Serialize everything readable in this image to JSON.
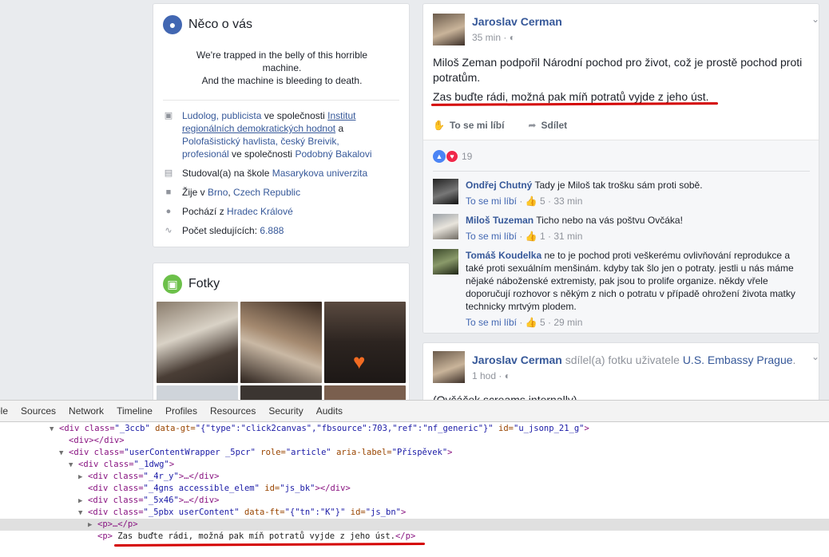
{
  "about": {
    "title": "Něco o vás",
    "quote_line1": "We're trapped in the belly of this horrible",
    "quote_line2": "machine.",
    "quote_line3": "And the machine is bleeding to death.",
    "work": {
      "role_link": "Ludolog, publicista",
      "at1": " ve společnosti ",
      "org1": "Institut regionálních demokratických hodnot",
      "and": " a ",
      "role2": "Polofašistický havlista, český Breivik, profesionál",
      "at2": " ve společnosti ",
      "org2": "Podobný Bakalovi"
    },
    "studied_prefix": "Studoval(a) na škole ",
    "studied_link": "Masarykova univerzita",
    "lives_prefix": "Žije v ",
    "lives_city": "Brno",
    "lives_sep": ", ",
    "lives_country": "Czech Republic",
    "from_prefix": "Pochází z ",
    "from_link": "Hradec Králové",
    "followers_prefix": "Počet sledujících: ",
    "followers_count": "6.888"
  },
  "photos": {
    "title": "Fotky"
  },
  "post": {
    "author": "Jaroslav Cerman",
    "time": "35 min",
    "privacy_icon": "globe-icon",
    "text1": "Miloš Zeman podpořil Národní pochod pro život, což je prostě pochod proti potratům.",
    "text2": "Zas buďte rádi, možná pak míň potratů vyjde z jeho úst.",
    "like_label": "To se mi líbí",
    "share_label": "Sdílet",
    "reaction_count": "19",
    "comments": [
      {
        "name": "Ondřej Chutný",
        "text": "Tady je Miloš tak trošku sám proti sobě.",
        "like": "To se mi líbí",
        "likes": "5",
        "time": "33 min"
      },
      {
        "name": "Miloš Tuzeman",
        "text": "Ticho nebo na vás poštvu Ovčáka!",
        "like": "To se mi líbí",
        "likes": "1",
        "time": "31 min"
      },
      {
        "name": "Tomáš Koudelka",
        "text": "ne to je pochod proti veškerému ovlivňování reprodukce a také proti sexuálním menšinám. kdyby tak šlo jen o potraty. jestli u nás máme nějaké náboženské extremisty, pak jsou to prolife organize. někdy vřele doporučují rozhovor s někým z nich o potratu v případě ohrožení života matky technicky mrtvým plodem.",
        "like": "To se mi líbí",
        "likes": "5",
        "time": "29 min"
      }
    ]
  },
  "post2": {
    "author": "Jaroslav Cerman",
    "action": " sdílel(a) fotku uživatele ",
    "page": "U.S. Embassy Prague",
    "dot": ".",
    "time": "1 hod",
    "text": "(Ovčáček screams internally)"
  },
  "devtools": {
    "tabs": [
      "ole",
      "Sources",
      "Network",
      "Timeline",
      "Profiles",
      "Resources",
      "Security",
      "Audits"
    ],
    "lines": [
      {
        "open": "<div class=",
        "cls": "\"_3ccb\"",
        "a2": " data-gt=",
        "v2": "\"{\"type\":\"click2canvas\",\"fbsource\":703,\"ref\":\"nf_generic\"}\"",
        "a3": " id=",
        "v3": "\"u_jsonp_21_g\"",
        "close": ">"
      },
      {
        "tag": "<div></div>"
      },
      {
        "open": "<div class=",
        "cls": "\"userContentWrapper _5pcr\"",
        "a2": " role=",
        "v2": "\"article\"",
        "a3": " aria-label=",
        "v3": "\"Příspěvek\"",
        "close": ">"
      },
      {
        "open": "<div class=",
        "cls": "\"_1dwg\"",
        "close": ">"
      },
      {
        "open": "<div class=",
        "cls": "\"_4r_y\"",
        "close": ">…</div>"
      },
      {
        "open": "<div class=",
        "cls": "\"_4gns accessible_elem\"",
        "a2": " id=",
        "v2": "\"js_bk\"",
        "close": "></div>"
      },
      {
        "open": "<div class=",
        "cls": "\"_5x46\"",
        "close": ">…</div>"
      },
      {
        "open": "<div class=",
        "cls": "\"_5pbx userContent\"",
        "a2": " data-ft=",
        "v2": "\"{\"tn\":\"K\"}\"",
        "a3": " id=",
        "v3": "\"js_bn\"",
        "close": ">"
      },
      {
        "tag": "<p>…</p>"
      },
      {
        "tag_open": "<p>",
        "text": " Zas buďte rádi, možná pak míň potratů vyjde z jeho úst.",
        "tag_close": "</p>"
      }
    ]
  }
}
